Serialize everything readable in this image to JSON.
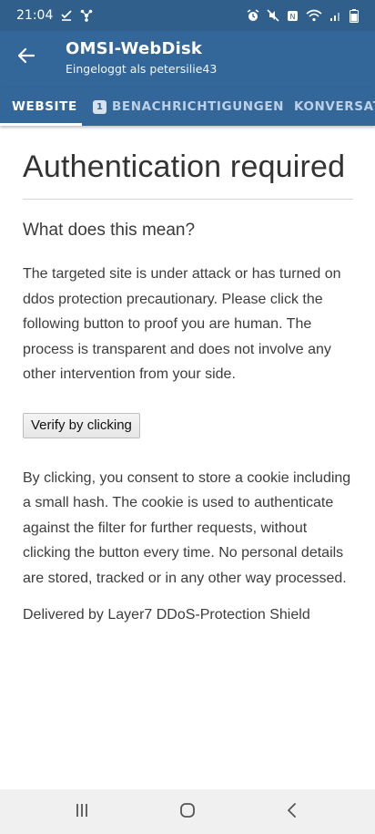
{
  "status_bar": {
    "time": "21:04",
    "left_icons": [
      "download-done-icon",
      "app-notification-icon"
    ],
    "right_icons": [
      "alarm-icon",
      "mute-icon",
      "data-saver-icon",
      "wifi-icon",
      "signal-icon",
      "battery-icon"
    ]
  },
  "app_bar": {
    "back_icon": "arrow-back-icon",
    "title": "OMSI-WebDisk",
    "subtitle": "Eingeloggt als petersilie43"
  },
  "tabs": [
    {
      "label": "WEBSITE",
      "active": true
    },
    {
      "label": "BENACHRICHTIGUNGEN",
      "badge": "1",
      "active": false
    },
    {
      "label": "KONVERSAT",
      "active": false
    }
  ],
  "page": {
    "heading": "Authentication required",
    "subheading": "What does this mean?",
    "paragraph1": "The targeted site is under attack or has turned on ddos protection precautionary. Please click the following button to proof you are human. The process is transparent and does not involve any other intervention from your side.",
    "verify_button": "Verify by clicking",
    "paragraph2": "By clicking, you consent to store a cookie including a small hash. The cookie is used to authenticate against the filter for further requests, without clicking the button every time. No personal details are stored, tracked or in any other way processed.",
    "footer_text": "Delivered by Layer7 DDoS-Protection Shield"
  },
  "nav_bar": {
    "icons": [
      "recent-apps-icon",
      "home-icon",
      "back-icon"
    ]
  },
  "colors": {
    "status_bar": "#2f5f8a",
    "app_bar": "#336699",
    "tab_inactive_text": "#bcd0e6",
    "nav_bar": "#f0f0f0"
  }
}
